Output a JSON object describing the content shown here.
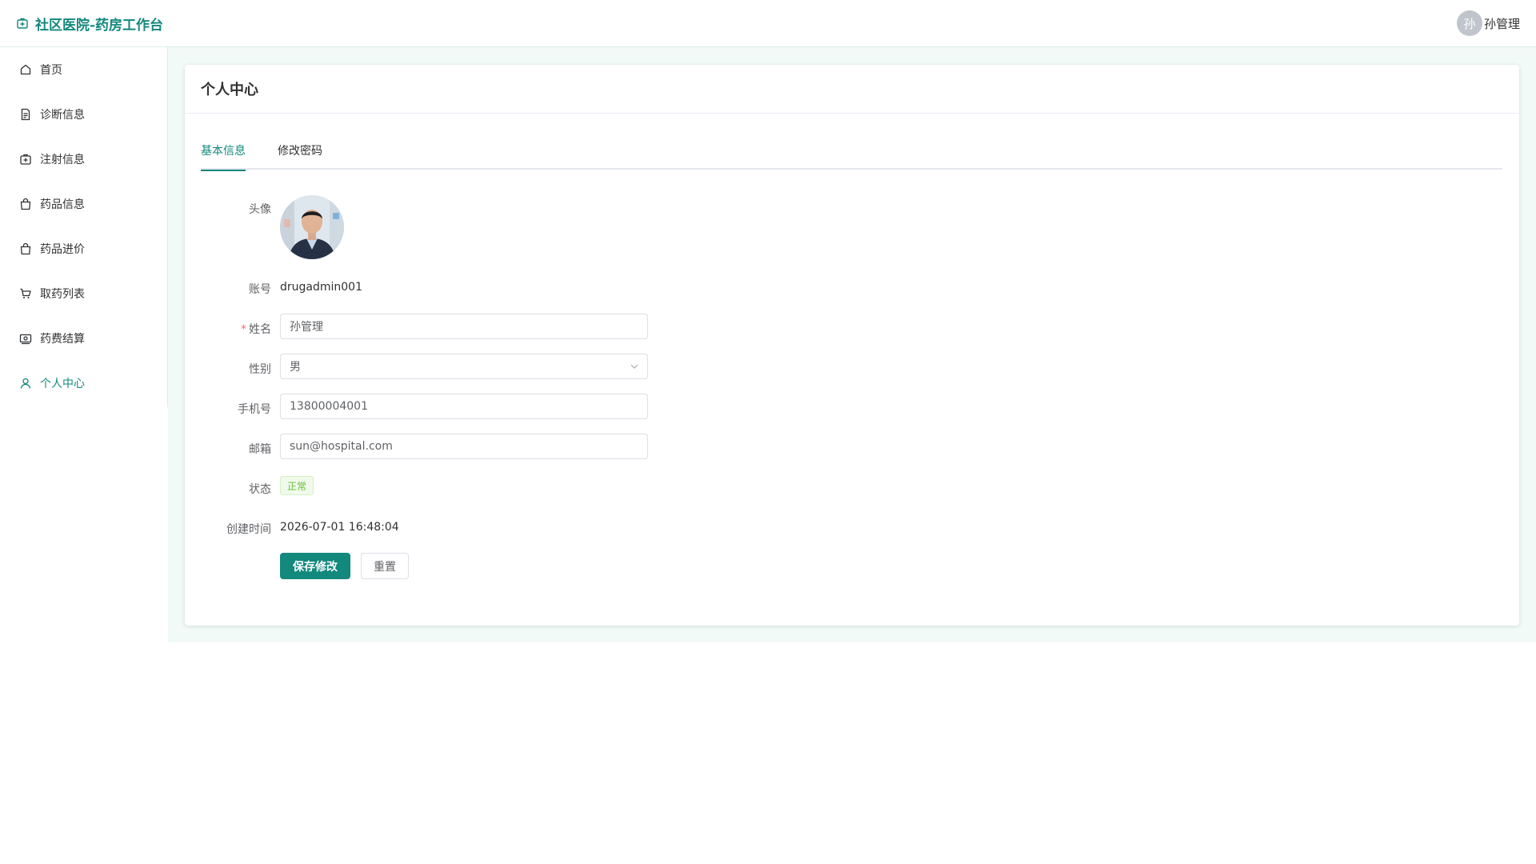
{
  "header": {
    "brand_title": "社区医院-药房工作台",
    "user_avatar_char": "孙",
    "user_name": "孙管理"
  },
  "sidebar": {
    "items": [
      {
        "label": "首页",
        "icon": "home-icon"
      },
      {
        "label": "诊断信息",
        "icon": "document-icon"
      },
      {
        "label": "注射信息",
        "icon": "medical-kit-icon"
      },
      {
        "label": "药品信息",
        "icon": "bag-icon"
      },
      {
        "label": "药品进价",
        "icon": "bag-icon"
      },
      {
        "label": "取药列表",
        "icon": "cart-icon"
      },
      {
        "label": "药费结算",
        "icon": "money-icon"
      },
      {
        "label": "个人中心",
        "icon": "user-icon",
        "active": true
      }
    ]
  },
  "card": {
    "title": "个人中心",
    "tabs": [
      {
        "label": "基本信息",
        "active": true
      },
      {
        "label": "修改密码",
        "active": false
      }
    ]
  },
  "form": {
    "avatar_label": "头像",
    "account_label": "账号",
    "account_value": "drugadmin001",
    "name_label": "姓名",
    "name_value": "孙管理",
    "gender_label": "性别",
    "gender_value": "男",
    "phone_label": "手机号",
    "phone_value": "13800004001",
    "email_label": "邮箱",
    "email_value": "sun@hospital.com",
    "status_label": "状态",
    "status_value": "正常",
    "created_label": "创建时间",
    "created_value": "2026-07-01 16:48:04",
    "save_button": "保存修改",
    "reset_button": "重置"
  },
  "colors": {
    "accent": "#13887d",
    "success": "#67c23a",
    "required": "#f56c6c"
  }
}
